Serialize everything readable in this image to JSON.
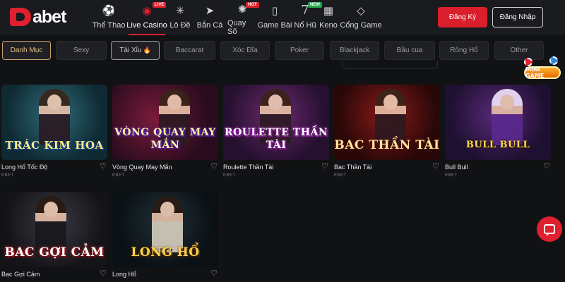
{
  "header": {
    "logo_text": "abet",
    "nav": [
      {
        "label": "Thể Thao",
        "icon": "soccer-ball-icon"
      },
      {
        "label": "Live Casino",
        "icon": "casino-chip-icon",
        "badge": "LIVE",
        "active": true
      },
      {
        "label": "Lô Đề",
        "icon": "ferris-wheel-icon"
      },
      {
        "label": "Bắn Cá",
        "icon": "fish-icon"
      },
      {
        "label": "Quay Số",
        "icon": "lottery-wheel-icon",
        "badge": "HOT"
      },
      {
        "label": "Game Bài",
        "icon": "playing-card-icon"
      },
      {
        "label": "Nổ Hũ",
        "icon": "lucky-seven-icon",
        "badge": "NEW"
      },
      {
        "label": "Keno",
        "icon": "grid-icon"
      },
      {
        "label": "Cổng Game",
        "icon": "gamepad-shapes-icon"
      }
    ],
    "register_label": "Đăng Ký",
    "login_label": "Đăng Nhập"
  },
  "categories": [
    {
      "label": "Danh Mục",
      "state": "active"
    },
    {
      "label": "Sexy"
    },
    {
      "label": "Tài Xỉu",
      "state": "outlined",
      "fire": "🔥"
    },
    {
      "label": "Baccarat"
    },
    {
      "label": "Xóc Đĩa"
    },
    {
      "label": "Poker"
    },
    {
      "label": "Blackjack"
    },
    {
      "label": "Bầu cua"
    },
    {
      "label": "Rồng Hổ"
    },
    {
      "label": "Other"
    }
  ],
  "minigame_label": "MINI GAME",
  "games": [
    {
      "name": "Long Hổ Tốc Độ",
      "provider": "EBET",
      "art_title": "TRÁC KIM HOA"
    },
    {
      "name": "Vòng Quay May Mắn",
      "provider": "EBET",
      "art_title": "VÒNG QUAY MAY MẮN"
    },
    {
      "name": "Roulette Thần Tài",
      "provider": "EBET",
      "art_title": "ROULETTE THẦN TÀI"
    },
    {
      "name": "Bac Thần Tài",
      "provider": "EBET",
      "art_title": "BAC THẦN TÀI"
    },
    {
      "name": "Bull Bull",
      "provider": "EBET",
      "art_title": "BULL BULL"
    },
    {
      "name": "Bac Gợi Cảm",
      "provider": "",
      "art_title": "BAC GỢI CẢM"
    },
    {
      "name": "Long Hổ",
      "provider": "",
      "art_title": "LONG HỔ"
    }
  ],
  "colors": {
    "accent": "#e0202e",
    "background": "#111214",
    "category_active": "#e7c08a"
  }
}
